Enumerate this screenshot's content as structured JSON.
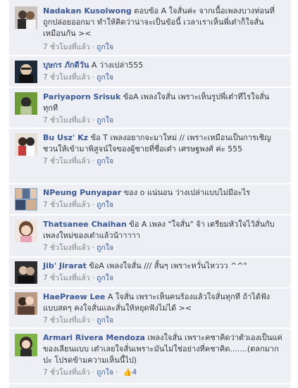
{
  "comments": [
    {
      "name": "Nadakan Kusolwong",
      "text": "ตอบข้อ A ใจสั่นค่ะ จากเนื้อเพลงบางท่อนที่ถูกปล่อยออกมา ทำให้คิดว่าน่าจะเป็นข้อนี้ เวลาเราเห็นพี่เต๋าก็ใจสั่นเหมือนกัน ><",
      "time": "7 ชั่วโมงที่แล้ว",
      "like": "ถูกใจ",
      "avatar": "avatar-couple-icon"
    },
    {
      "name": "บุษกร ภักดีวัน",
      "text": "A ว่างเปล่า555",
      "time": "7 ชั่วโมงที่แล้ว",
      "like": "ถูกใจ",
      "avatar": "avatar-person-icon"
    },
    {
      "name": "Pariyaporn Srisuk",
      "text": "ข้อA เพลงใจสั่น เพราะเห็นรูปพี่เต๋าทีไรใจสั่นทุกที",
      "time": "7 ชั่วโมงที่แล้ว",
      "like": "ถูกใจ",
      "avatar": "avatar-green-icon"
    },
    {
      "name": "Bu Usz' Kz",
      "text": "ข้อ T เพลงอยากจะมาใหม่ // เพราะเหมือนเป็นการเชิญชวนให้เข้ามาพิสูจน์ใจของผู้ชายที่ชื่อเต๋า เศรษฐพงศ์ ค่ะ 555",
      "time": "7 ชั่วโมงที่แล้ว",
      "like": "ถูกใจ",
      "avatar": "avatar-couple-icon"
    },
    {
      "name": "NPeung Punyapar",
      "text": "ของ o แน่นอน ว่างเปล่าแบบไม่มีอะไร",
      "time": "7 ชั่วโมงที่แล้ว",
      "like": "ถูกใจ",
      "avatar": "avatar-collage-icon"
    },
    {
      "name": "Thatsanee Chaihan",
      "text": "ข้อ A เพลง \"ใจสั่น\" จ้า เตรียมหัวใจไว้สั่นกับเพลงใหม่ของเต๋าแล้วน้าาาาา",
      "time": "7 ชั่วโมงที่แล้ว",
      "like": "ถูกใจ",
      "avatar": "avatar-girl-icon"
    },
    {
      "name": "Jib' Jirarat",
      "text": "ข้อA เพลงใจสั่น /// สั้นๆ เพราะหวั่นไหววว ^^\"",
      "time": "7 ชั่วโมงที่แล้ว",
      "like": "ถูกใจ",
      "avatar": "avatar-dark-icon"
    },
    {
      "name": "HaePraew Lee",
      "text": "A ใจสั่น เพราะเห็นคนร้องแล้วใจสั่นทุกที ถ้าได้ฟังแบบสดๆ คงใจสั่นและสั่นให้หยุดฟังไม่ได้ ><",
      "time": "7 ชั่วโมงที่แล้ว",
      "like": "ถูกใจ",
      "avatar": "avatar-couple-icon"
    },
    {
      "name": "Armari Rivera Mendoza",
      "text": "เพลงใจสั่น เพราะคชาคิดว่าตัวเองเป็นแค่ของเลียนแบบ เต๋าเลยใจสั่นเพราะมันไม่ใช่อย่างที่คชาคิด.......(ตลกมากปะ โปรดข้ามความเห็นนี้ไป)",
      "time": "7 ชั่วโมงที่แล้ว",
      "like": "ถูกใจ",
      "likes_count": "4",
      "avatar": "avatar-green-girl-icon"
    }
  ]
}
